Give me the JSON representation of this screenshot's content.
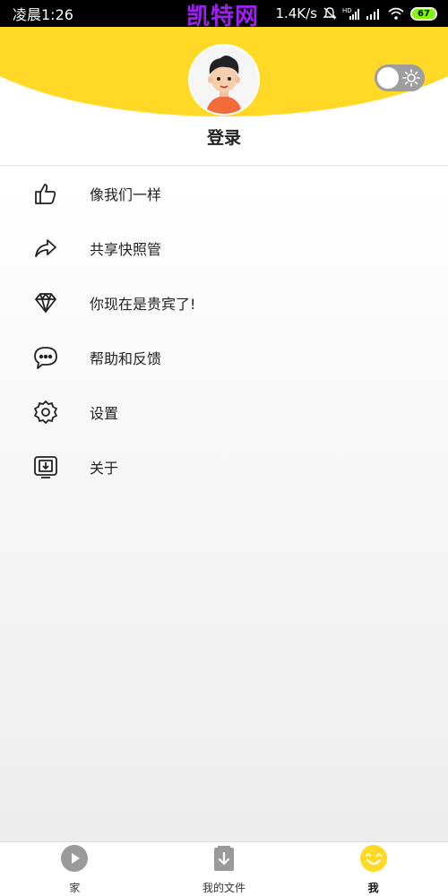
{
  "status_bar": {
    "time": "凌晨1:26",
    "watermark": "凯特网",
    "speed": "1.4K/s",
    "battery": "67",
    "icons": [
      "bell-off-icon",
      "hd-signal-icon",
      "signal-icon",
      "wifi-icon",
      "battery-icon"
    ]
  },
  "header": {
    "login_label": "登录",
    "avatar_icon": "user-avatar",
    "theme_toggle_icon": "sun-icon",
    "accent_color": "#ffd925"
  },
  "menu": {
    "items": [
      {
        "label": "像我们一样",
        "icon": "thumbs-up-icon"
      },
      {
        "label": "共享快照管",
        "icon": "share-icon"
      },
      {
        "label": "你现在是贵宾了!",
        "icon": "diamond-icon"
      },
      {
        "label": "帮助和反馈",
        "icon": "chat-bubble-icon"
      },
      {
        "label": "设置",
        "icon": "gear-icon"
      },
      {
        "label": "关于",
        "icon": "download-box-icon"
      }
    ]
  },
  "bottom_nav": {
    "items": [
      {
        "label": "家",
        "icon": "play-circle-icon",
        "active": false
      },
      {
        "label": "我的文件",
        "icon": "download-file-icon",
        "active": false
      },
      {
        "label": "我",
        "icon": "smile-icon",
        "active": true
      }
    ]
  }
}
